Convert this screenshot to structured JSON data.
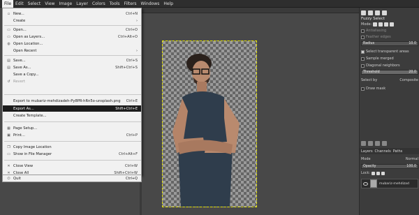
{
  "menubar": [
    "File",
    "Edit",
    "Select",
    "View",
    "Image",
    "Layer",
    "Colors",
    "Tools",
    "Filters",
    "Windows",
    "Help"
  ],
  "file_menu": [
    {
      "label": "New...",
      "shortcut": "Ctrl+N",
      "icon": "new-icon"
    },
    {
      "label": "Create",
      "shortcut": "›",
      "icon": ""
    },
    {
      "label": "Open...",
      "shortcut": "Ctrl+O",
      "icon": "open-icon"
    },
    {
      "label": "Open as Layers...",
      "shortcut": "Ctrl+Alt+O",
      "icon": "open-layers-icon"
    },
    {
      "label": "Open Location...",
      "shortcut": "",
      "icon": "location-icon"
    },
    {
      "label": "Open Recent",
      "shortcut": "›",
      "icon": ""
    },
    {
      "label": "Save...",
      "shortcut": "Ctrl+S",
      "icon": "save-icon"
    },
    {
      "label": "Save As...",
      "shortcut": "Shift+Ctrl+S",
      "icon": "save-as-icon"
    },
    {
      "label": "Save a Copy...",
      "shortcut": "",
      "icon": ""
    },
    {
      "label": "Revert",
      "shortcut": "",
      "icon": "revert-icon",
      "disabled": true
    },
    {
      "label": "Export to mubariz-mehdizadeh-Py8PR-hRn5o-unsplash.png",
      "shortcut": "Ctrl+E",
      "icon": ""
    },
    {
      "label": "Export As...",
      "shortcut": "Shift+Ctrl+E",
      "icon": "",
      "highlighted": true
    },
    {
      "label": "Create Template...",
      "shortcut": "",
      "icon": ""
    },
    {
      "label": "Page Setup...",
      "shortcut": "",
      "icon": "page-setup-icon"
    },
    {
      "label": "Print...",
      "shortcut": "Ctrl+P",
      "icon": "print-icon"
    },
    {
      "label": "Copy Image Location",
      "shortcut": "",
      "icon": "copy-icon"
    },
    {
      "label": "Show in File Manager",
      "shortcut": "Ctrl+Alt+F",
      "icon": "folder-icon"
    },
    {
      "label": "Close View",
      "shortcut": "Ctrl+W",
      "icon": "close-icon"
    },
    {
      "label": "Close All",
      "shortcut": "Shift+Ctrl+W",
      "icon": "close-all-icon"
    },
    {
      "label": "Quit",
      "shortcut": "Ctrl+Q",
      "icon": "quit-icon"
    }
  ],
  "tool_options": {
    "title": "Fuzzy Select",
    "mode_label": "Mode:",
    "antialiasing": "Antialiasing",
    "feather_edges": "Feather edges",
    "radius_label": "Radius",
    "radius_value": "10.0",
    "select_transparent": "Select transparent areas",
    "sample_merged": "Sample merged",
    "diagonal_neighbors": "Diagonal neighbors",
    "threshold_label": "Threshold",
    "threshold_value": "20.0",
    "select_by_label": "Select by",
    "select_by_value": "Composite",
    "draw_mask": "Draw mask"
  },
  "layers_panel": {
    "tabs": [
      "Layers",
      "Channels",
      "Paths"
    ],
    "mode_label": "Mode",
    "mode_value": "Normal",
    "opacity_label": "Opacity",
    "opacity_value": "100.0",
    "lock_label": "Lock:",
    "layer_name": "mubariz-mehdizad"
  },
  "colors": {
    "accent": "#1c1c1c",
    "menu_bg": "#f1f1f1",
    "canvas_bg": "#484848"
  }
}
